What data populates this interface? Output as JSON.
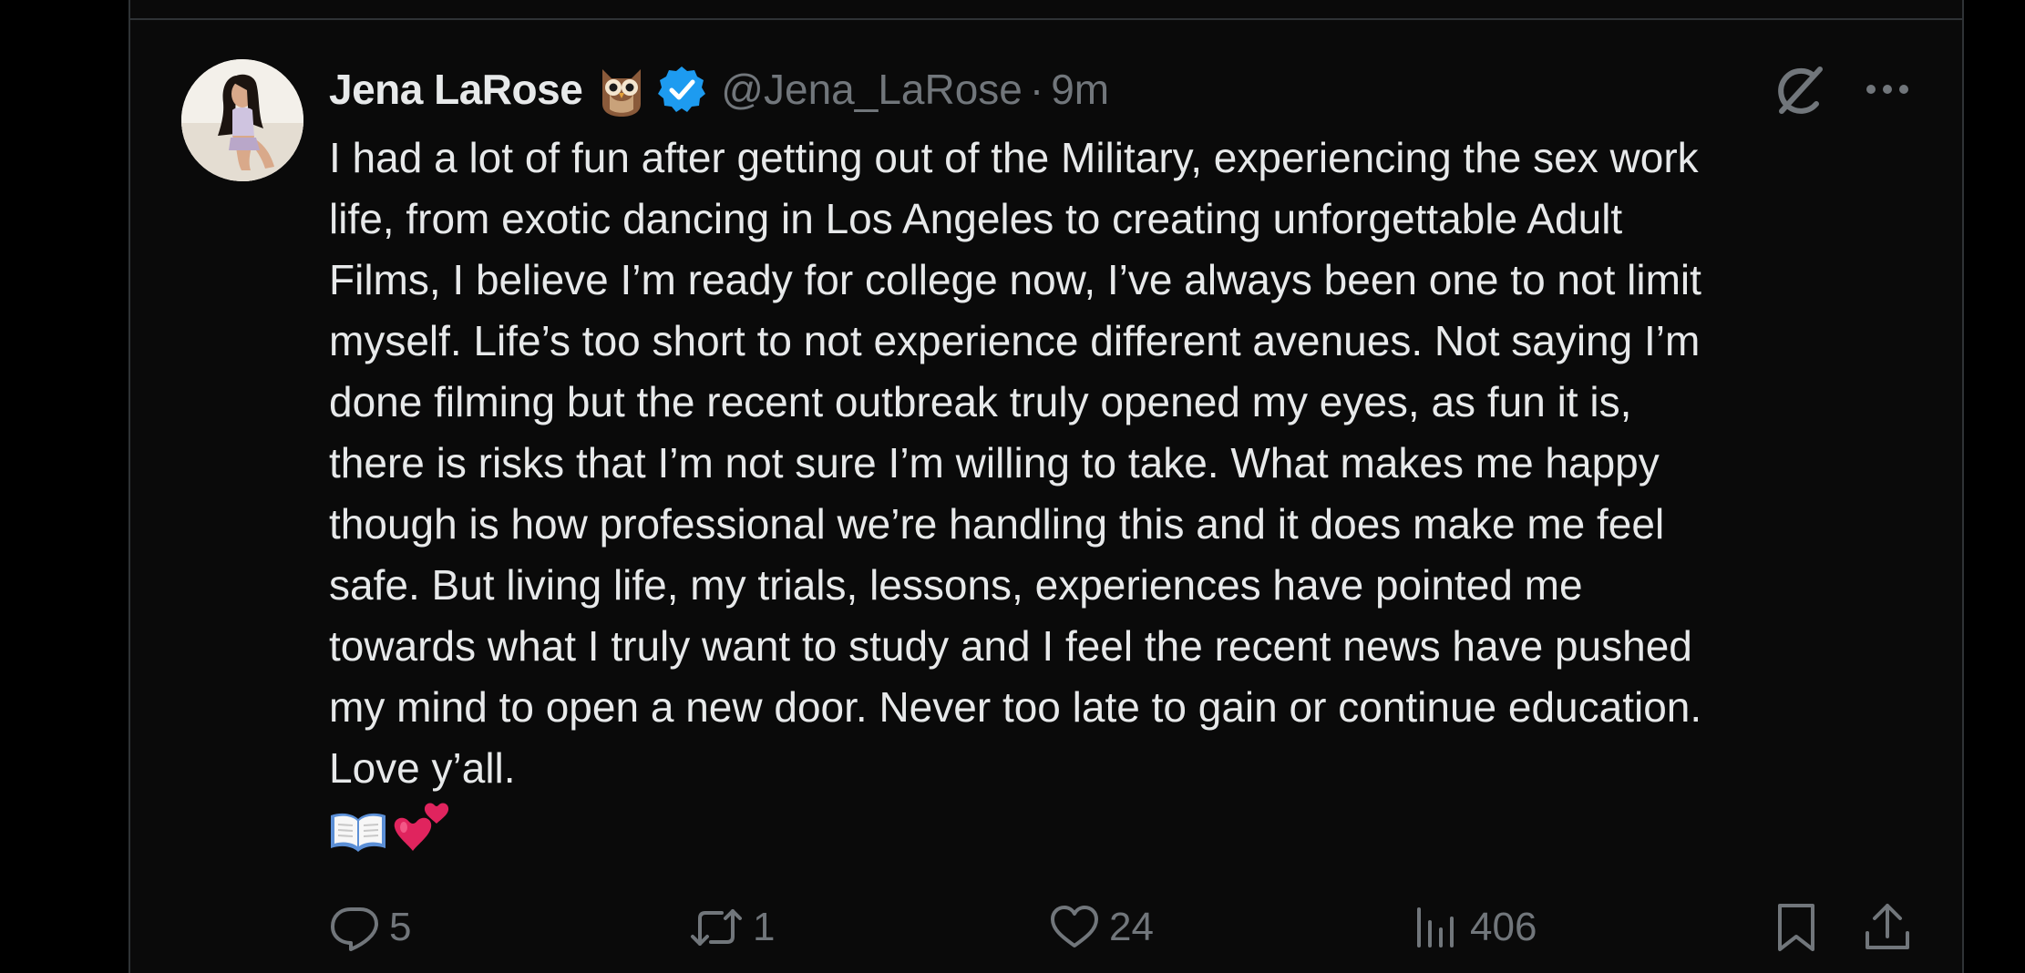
{
  "tweet": {
    "author": {
      "display_name": "Jena LaRose",
      "handle": "@Jena_LaRose",
      "name_emoji": "owl-emoji",
      "verified": true,
      "separator": "·",
      "time": "9m"
    },
    "text": "I had a lot of fun after getting out of the Military, experiencing the sex work\nlife, from exotic dancing in Los Angeles to creating unforgettable Adult\nFilms, I believe I’m ready for college now, I’ve always been one to not limit\nmyself. Life’s too short to not experience different avenues. Not saying I’m\ndone filming but the recent outbreak truly opened my eyes, as fun it is,\nthere is risks that I’m not sure I’m willing to take. What makes me happy\nthough is how professional we’re handling this and it does make me feel\nsafe. But living life, my trials, lessons, experiences have pointed me\ntowards what I truly want to study and I feel the recent news have pushed\nmy mind to open a new door. Never too late to gain or continue education.\nLove y’all.",
    "trailing_emojis": [
      "open-book-emoji",
      "two-hearts-emoji"
    ],
    "stats": {
      "replies": "5",
      "reposts": "1",
      "likes": "24",
      "views": "406"
    }
  },
  "icons": {
    "verified": "verified-badge-icon",
    "grok": "grok-icon",
    "more": "more-icon",
    "reply": "reply-icon",
    "repost": "repost-icon",
    "like": "heart-icon",
    "views": "views-icon",
    "bookmark": "bookmark-icon",
    "share": "share-icon"
  },
  "colors": {
    "background": "#000000",
    "text_primary": "#e7e9ea",
    "text_secondary": "#71767b",
    "verified_blue": "#1d9bf0",
    "border": "#2f3336"
  }
}
